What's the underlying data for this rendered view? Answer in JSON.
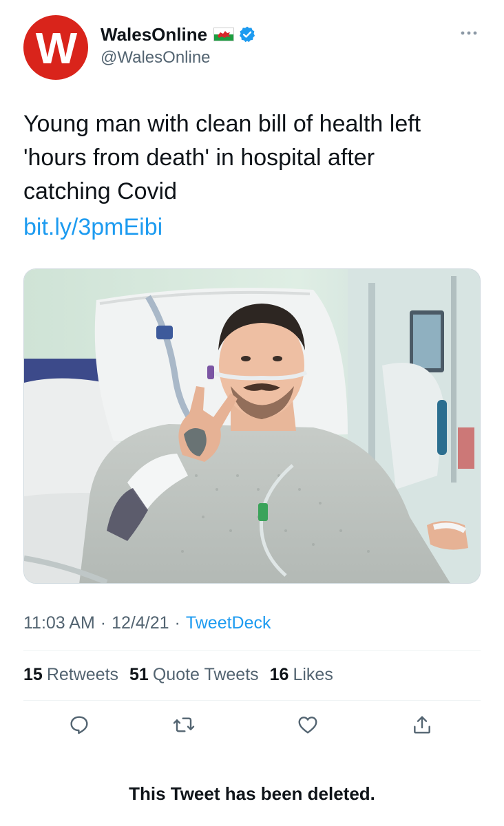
{
  "author": {
    "avatar_letter": "W",
    "display_name": "WalesOnline",
    "handle": "@WalesOnline",
    "flag_icon": "wales-flag-icon",
    "verified_icon": "verified-badge-icon",
    "brand_color": "#d9241b"
  },
  "tweet": {
    "text": "Young man with clean bill of health left\n'hours from death' in hospital after\ncatching Covid",
    "link": "bit.ly/3pmEibi",
    "media_alt_icon": "photo-of-patient-in-hospital-bed"
  },
  "meta": {
    "time": "11:03 AM",
    "date": "12/4/21",
    "source": "TweetDeck"
  },
  "stats": {
    "retweets_count": "15",
    "retweets_label": "Retweets",
    "quotes_count": "51",
    "quotes_label": "Quote Tweets",
    "likes_count": "16",
    "likes_label": "Likes"
  },
  "actions": {
    "reply_icon": "reply-icon",
    "retweet_icon": "retweet-icon",
    "like_icon": "heart-icon",
    "share_icon": "share-icon"
  },
  "notice": {
    "deleted_text": "This Tweet has been deleted."
  },
  "colors": {
    "link": "#1d9bf0",
    "secondary_text": "#536471",
    "divider": "#eff3f4"
  }
}
